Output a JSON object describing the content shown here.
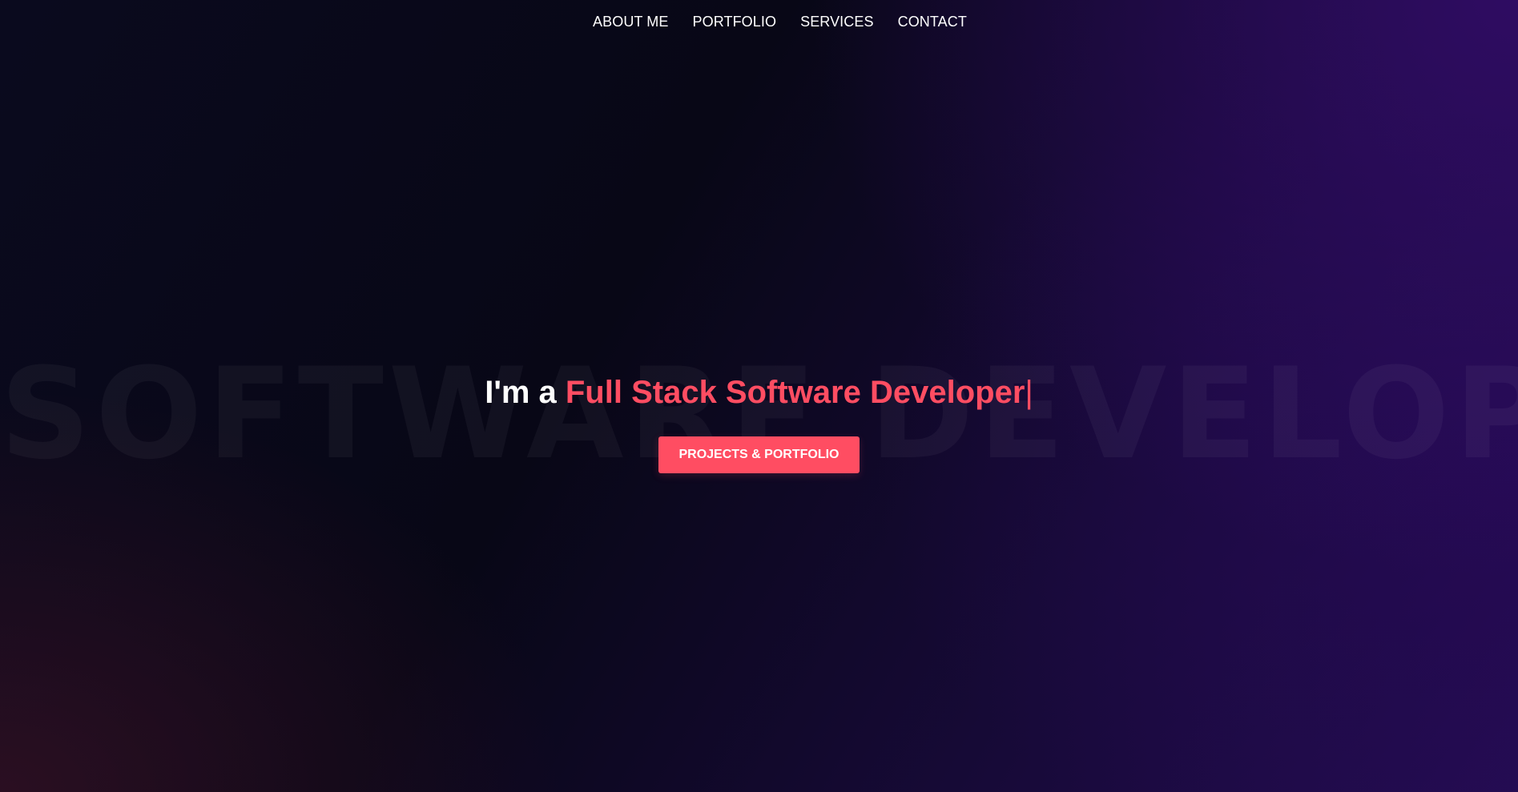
{
  "nav": {
    "items": [
      {
        "label": "ABOUT ME"
      },
      {
        "label": "PORTFOLIO"
      },
      {
        "label": "SERVICES"
      },
      {
        "label": "CONTACT"
      }
    ]
  },
  "hero": {
    "background_word": "SOFTWARE DEVELOPER",
    "headline_prefix": "I'm a ",
    "headline_role": "Full Stack Software Developer",
    "typing_cursor": "|",
    "cta_label": "PROJECTS & PORTFOLIO"
  },
  "colors": {
    "accent": "#ff4d62",
    "text": "#ffffff",
    "background_dark": "#080716",
    "background_purple": "#240c52"
  }
}
